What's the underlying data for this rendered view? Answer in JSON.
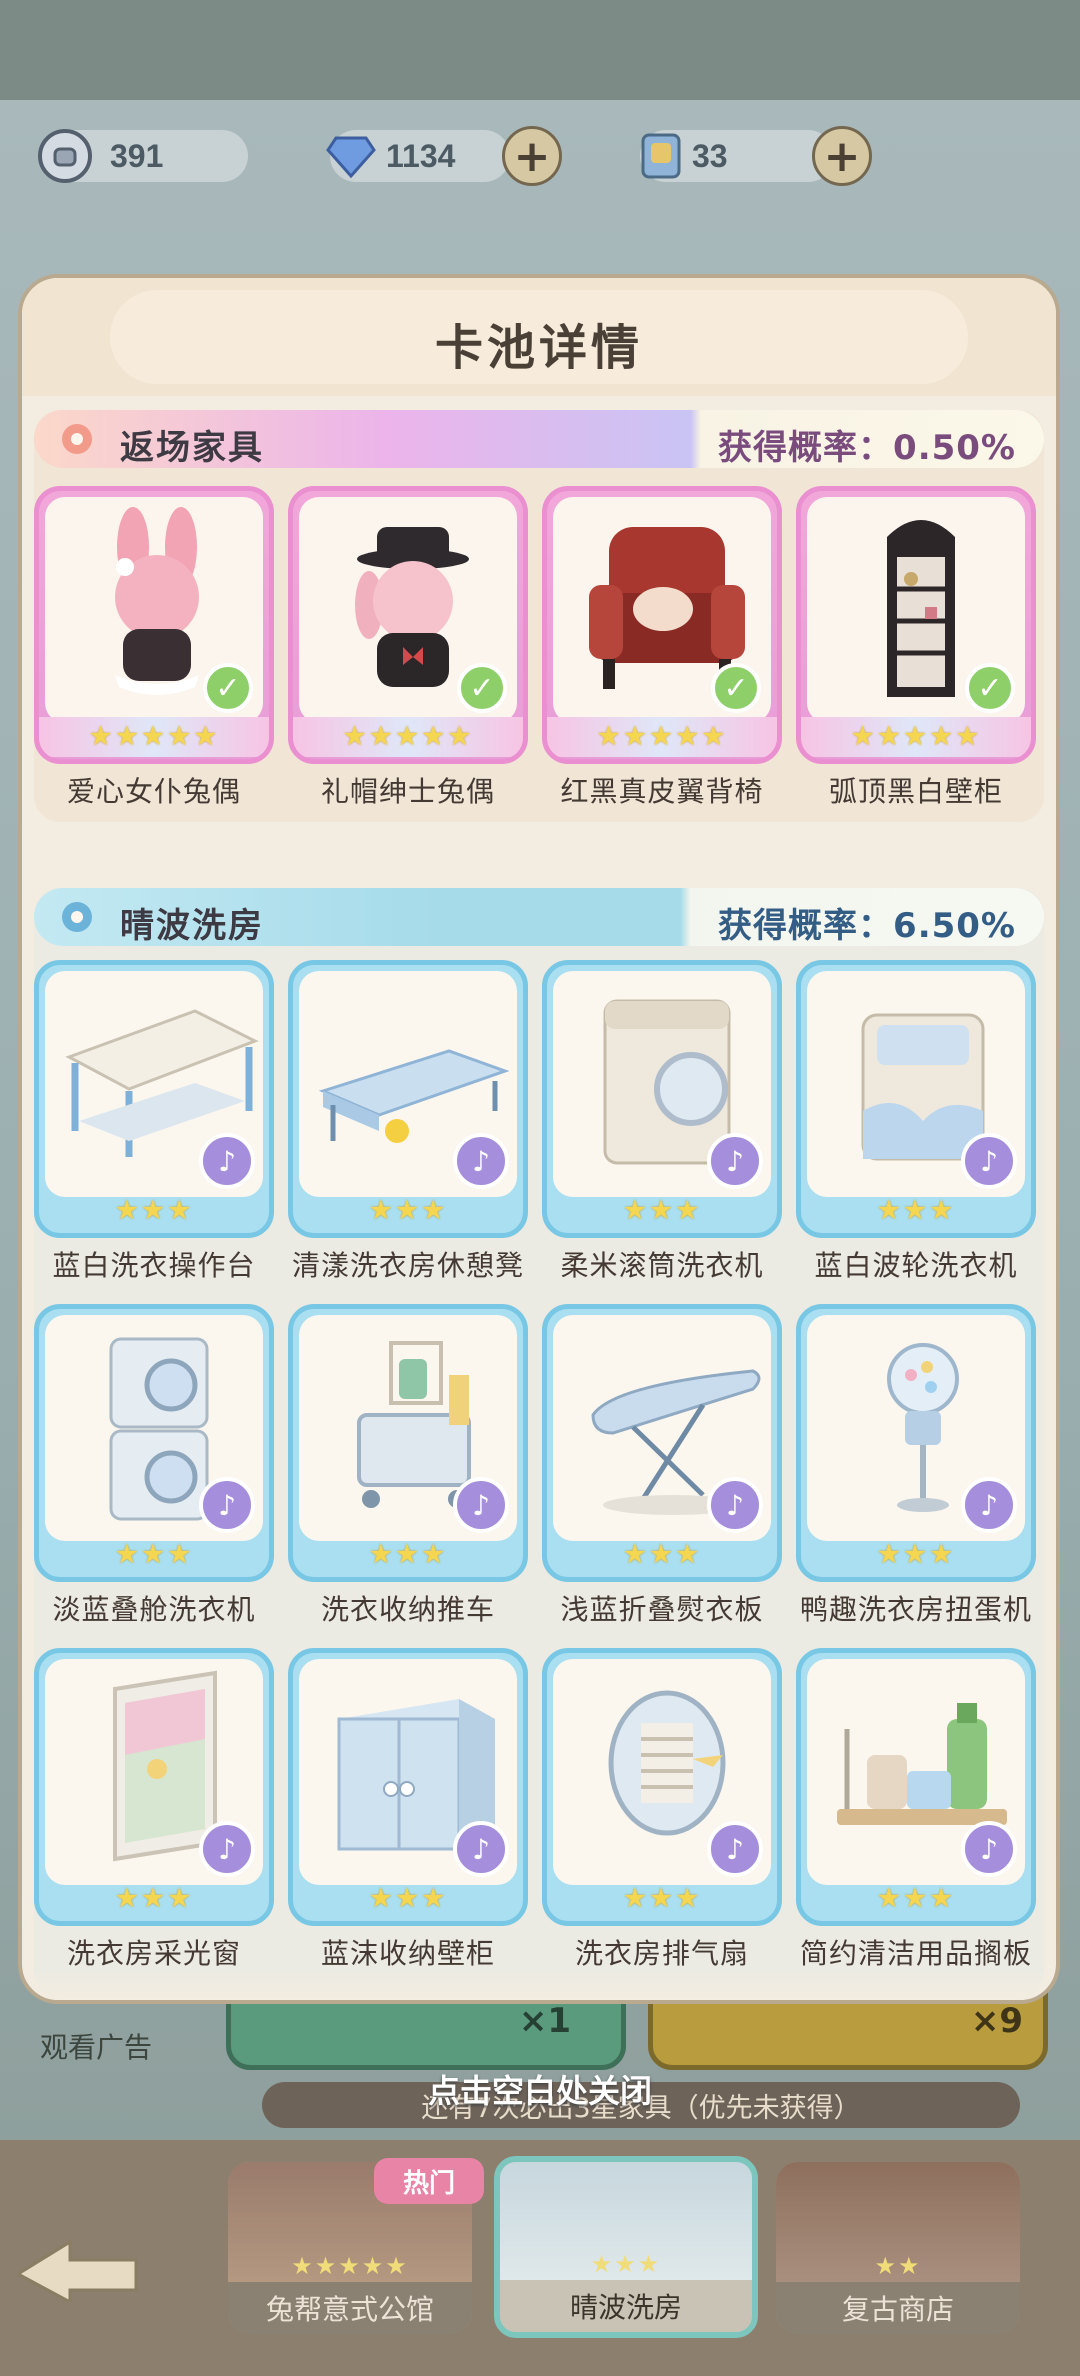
{
  "hud": {
    "coins": "391",
    "diamonds": "1134",
    "tickets": "33",
    "coin_icon": "bag-icon",
    "diamond_icon": "diamond-icon",
    "ticket_icon": "ticket-icon"
  },
  "modal": {
    "title": "卡池详情",
    "sections": [
      {
        "name": "返场家具",
        "rate_label": "获得概率：0.50%",
        "color": "#ea8fcf",
        "items": [
          {
            "name": "爱心女仆兔偶",
            "stars": "★★★★★",
            "owned": true
          },
          {
            "name": "礼帽绅士兔偶",
            "stars": "★★★★★",
            "owned": true
          },
          {
            "name": "红黑真皮翼背椅",
            "stars": "★★★★★",
            "owned": true
          },
          {
            "name": "弧顶黑白壁柜",
            "stars": "★★★★★",
            "owned": true
          }
        ]
      },
      {
        "name": "晴波洗房",
        "rate_label": "获得概率：6.50%",
        "color": "#78c7e4",
        "items": [
          {
            "name": "蓝白洗衣操作台",
            "stars": "★★★"
          },
          {
            "name": "清漾洗衣房休憩凳",
            "stars": "★★★"
          },
          {
            "name": "柔米滚筒洗衣机",
            "stars": "★★★"
          },
          {
            "name": "蓝白波轮洗衣机",
            "stars": "★★★"
          },
          {
            "name": "淡蓝叠舱洗衣机",
            "stars": "★★★"
          },
          {
            "name": "洗衣收纳推车",
            "stars": "★★★"
          },
          {
            "name": "浅蓝折叠熨衣板",
            "stars": "★★★"
          },
          {
            "name": "鸭趣洗衣房扭蛋机",
            "stars": "★★★"
          },
          {
            "name": "洗衣房采光窗",
            "stars": "★★★"
          },
          {
            "name": "蓝沫收纳壁柜",
            "stars": "★★★"
          },
          {
            "name": "洗衣房排气扇",
            "stars": "★★★"
          },
          {
            "name": "简约清洁用品搁板",
            "stars": "★★★"
          }
        ]
      }
    ],
    "check_icon": "✓",
    "note_icon": "♪"
  },
  "background": {
    "watch_ad": "观看广告",
    "single_x": "×1",
    "ten_x": "×9",
    "pity_note": "还有7次必出3星家具（优先未获得）"
  },
  "close_hint": "点击空白处关闭",
  "tabs": [
    {
      "label": "兔帮意式公馆",
      "stars": "★★★★★"
    },
    {
      "label": "晴波洗房",
      "stars": "★★★"
    },
    {
      "label": "复古商店",
      "stars": "★★"
    }
  ],
  "hot_badge": "热门"
}
